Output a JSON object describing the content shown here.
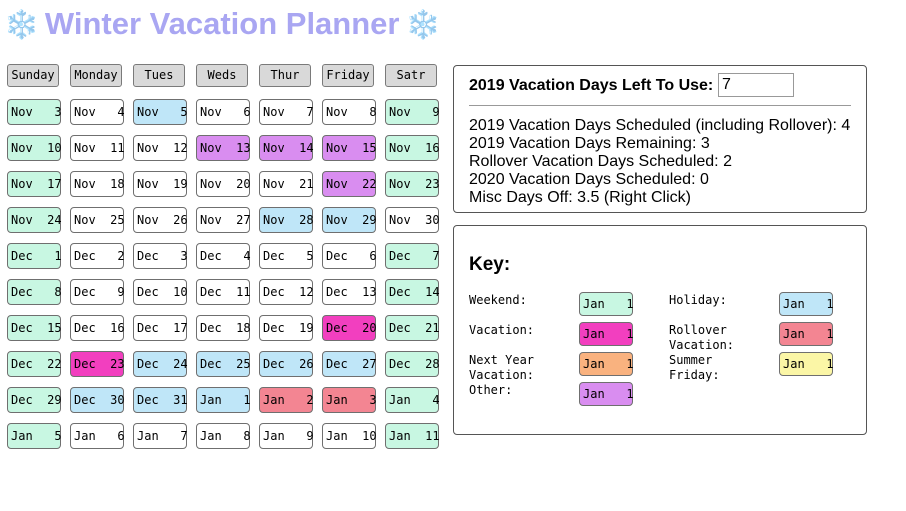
{
  "title": {
    "left_icon": "snowflake-icon",
    "text": "Winter Vacation Planner",
    "right_icon": "snowflake-icon",
    "glyph": "❄️",
    "color": "#a9a6f2"
  },
  "colors": {
    "weekend": "#c8f7e2",
    "holiday": "#bfe6f8",
    "vacation": "#f23fbf",
    "rollover": "#f38592",
    "other": "#d98df0",
    "nextyear": "#f9b27f",
    "summer": "#fbf6a6",
    "normal": "#ffffff"
  },
  "calendar": {
    "headers": [
      "Sunday",
      "Monday",
      "Tues",
      "Weds",
      "Thur",
      "Friday",
      "Satr"
    ],
    "weeks": [
      [
        {
          "m": "Nov",
          "d": "3",
          "t": "weekend"
        },
        {
          "m": "Nov",
          "d": "4",
          "t": "normal"
        },
        {
          "m": "Nov",
          "d": "5",
          "t": "holiday"
        },
        {
          "m": "Nov",
          "d": "6",
          "t": "normal"
        },
        {
          "m": "Nov",
          "d": "7",
          "t": "normal"
        },
        {
          "m": "Nov",
          "d": "8",
          "t": "normal"
        },
        {
          "m": "Nov",
          "d": "9",
          "t": "weekend"
        }
      ],
      [
        {
          "m": "Nov",
          "d": "10",
          "t": "weekend"
        },
        {
          "m": "Nov",
          "d": "11",
          "t": "normal"
        },
        {
          "m": "Nov",
          "d": "12",
          "t": "normal"
        },
        {
          "m": "Nov",
          "d": "13",
          "t": "other"
        },
        {
          "m": "Nov",
          "d": "14",
          "t": "other"
        },
        {
          "m": "Nov",
          "d": "15",
          "t": "other"
        },
        {
          "m": "Nov",
          "d": "16",
          "t": "weekend"
        }
      ],
      [
        {
          "m": "Nov",
          "d": "17",
          "t": "weekend"
        },
        {
          "m": "Nov",
          "d": "18",
          "t": "normal"
        },
        {
          "m": "Nov",
          "d": "19",
          "t": "normal"
        },
        {
          "m": "Nov",
          "d": "20",
          "t": "normal"
        },
        {
          "m": "Nov",
          "d": "21",
          "t": "normal"
        },
        {
          "m": "Nov",
          "d": "22",
          "t": "other"
        },
        {
          "m": "Nov",
          "d": "23",
          "t": "weekend"
        }
      ],
      [
        {
          "m": "Nov",
          "d": "24",
          "t": "weekend"
        },
        {
          "m": "Nov",
          "d": "25",
          "t": "normal"
        },
        {
          "m": "Nov",
          "d": "26",
          "t": "normal"
        },
        {
          "m": "Nov",
          "d": "27",
          "t": "normal"
        },
        {
          "m": "Nov",
          "d": "28",
          "t": "holiday"
        },
        {
          "m": "Nov",
          "d": "29",
          "t": "holiday"
        },
        {
          "m": "Nov",
          "d": "30",
          "t": "normal"
        }
      ],
      [
        {
          "m": "Dec",
          "d": "1",
          "t": "weekend"
        },
        {
          "m": "Dec",
          "d": "2",
          "t": "normal"
        },
        {
          "m": "Dec",
          "d": "3",
          "t": "normal"
        },
        {
          "m": "Dec",
          "d": "4",
          "t": "normal"
        },
        {
          "m": "Dec",
          "d": "5",
          "t": "normal"
        },
        {
          "m": "Dec",
          "d": "6",
          "t": "normal"
        },
        {
          "m": "Dec",
          "d": "7",
          "t": "weekend"
        }
      ],
      [
        {
          "m": "Dec",
          "d": "8",
          "t": "weekend"
        },
        {
          "m": "Dec",
          "d": "9",
          "t": "normal"
        },
        {
          "m": "Dec",
          "d": "10",
          "t": "normal"
        },
        {
          "m": "Dec",
          "d": "11",
          "t": "normal"
        },
        {
          "m": "Dec",
          "d": "12",
          "t": "normal"
        },
        {
          "m": "Dec",
          "d": "13",
          "t": "normal"
        },
        {
          "m": "Dec",
          "d": "14",
          "t": "weekend"
        }
      ],
      [
        {
          "m": "Dec",
          "d": "15",
          "t": "weekend"
        },
        {
          "m": "Dec",
          "d": "16",
          "t": "normal"
        },
        {
          "m": "Dec",
          "d": "17",
          "t": "normal"
        },
        {
          "m": "Dec",
          "d": "18",
          "t": "normal"
        },
        {
          "m": "Dec",
          "d": "19",
          "t": "normal"
        },
        {
          "m": "Dec",
          "d": "20",
          "t": "vacation"
        },
        {
          "m": "Dec",
          "d": "21",
          "t": "weekend"
        }
      ],
      [
        {
          "m": "Dec",
          "d": "22",
          "t": "weekend"
        },
        {
          "m": "Dec",
          "d": "23",
          "t": "vacation"
        },
        {
          "m": "Dec",
          "d": "24",
          "t": "holiday"
        },
        {
          "m": "Dec",
          "d": "25",
          "t": "holiday"
        },
        {
          "m": "Dec",
          "d": "26",
          "t": "holiday"
        },
        {
          "m": "Dec",
          "d": "27",
          "t": "holiday"
        },
        {
          "m": "Dec",
          "d": "28",
          "t": "weekend"
        }
      ],
      [
        {
          "m": "Dec",
          "d": "29",
          "t": "weekend"
        },
        {
          "m": "Dec",
          "d": "30",
          "t": "holiday"
        },
        {
          "m": "Dec",
          "d": "31",
          "t": "holiday"
        },
        {
          "m": "Jan",
          "d": "1",
          "t": "holiday"
        },
        {
          "m": "Jan",
          "d": "2",
          "t": "rollover"
        },
        {
          "m": "Jan",
          "d": "3",
          "t": "rollover"
        },
        {
          "m": "Jan",
          "d": "4",
          "t": "weekend"
        }
      ],
      [
        {
          "m": "Jan",
          "d": "5",
          "t": "weekend"
        },
        {
          "m": "Jan",
          "d": "6",
          "t": "normal"
        },
        {
          "m": "Jan",
          "d": "7",
          "t": "normal"
        },
        {
          "m": "Jan",
          "d": "8",
          "t": "normal"
        },
        {
          "m": "Jan",
          "d": "9",
          "t": "normal"
        },
        {
          "m": "Jan",
          "d": "10",
          "t": "normal"
        },
        {
          "m": "Jan",
          "d": "11",
          "t": "weekend"
        }
      ]
    ]
  },
  "summary": {
    "days_left_label": "2019 Vacation Days Left To Use:",
    "days_left_value": "7",
    "lines": [
      "2019 Vacation Days Scheduled (including Rollover): 4",
      "2019 Vacation Days Remaining: 3",
      "Rollover Vacation Days Scheduled: 2",
      "2020 Vacation Days Scheduled: 0",
      "Misc Days Off: 3.5 (Right Click)"
    ]
  },
  "key": {
    "title": "Key:",
    "sample": "Jan   1",
    "items": [
      {
        "name": "weekend",
        "label": "Weekend:",
        "t": "weekend"
      },
      {
        "name": "holiday",
        "label": "Holiday:",
        "t": "holiday"
      },
      {
        "name": "vacation",
        "label": "Vacation:",
        "t": "vacation"
      },
      {
        "name": "rollover",
        "label": "Rollover\nVacation:",
        "t": "rollover"
      },
      {
        "name": "next-year",
        "label": "Next Year\nVacation:",
        "t": "nextyear"
      },
      {
        "name": "summer-friday",
        "label": "Summer\nFriday:",
        "t": "summer"
      },
      {
        "name": "other",
        "label": "Other:",
        "t": "other"
      }
    ]
  }
}
